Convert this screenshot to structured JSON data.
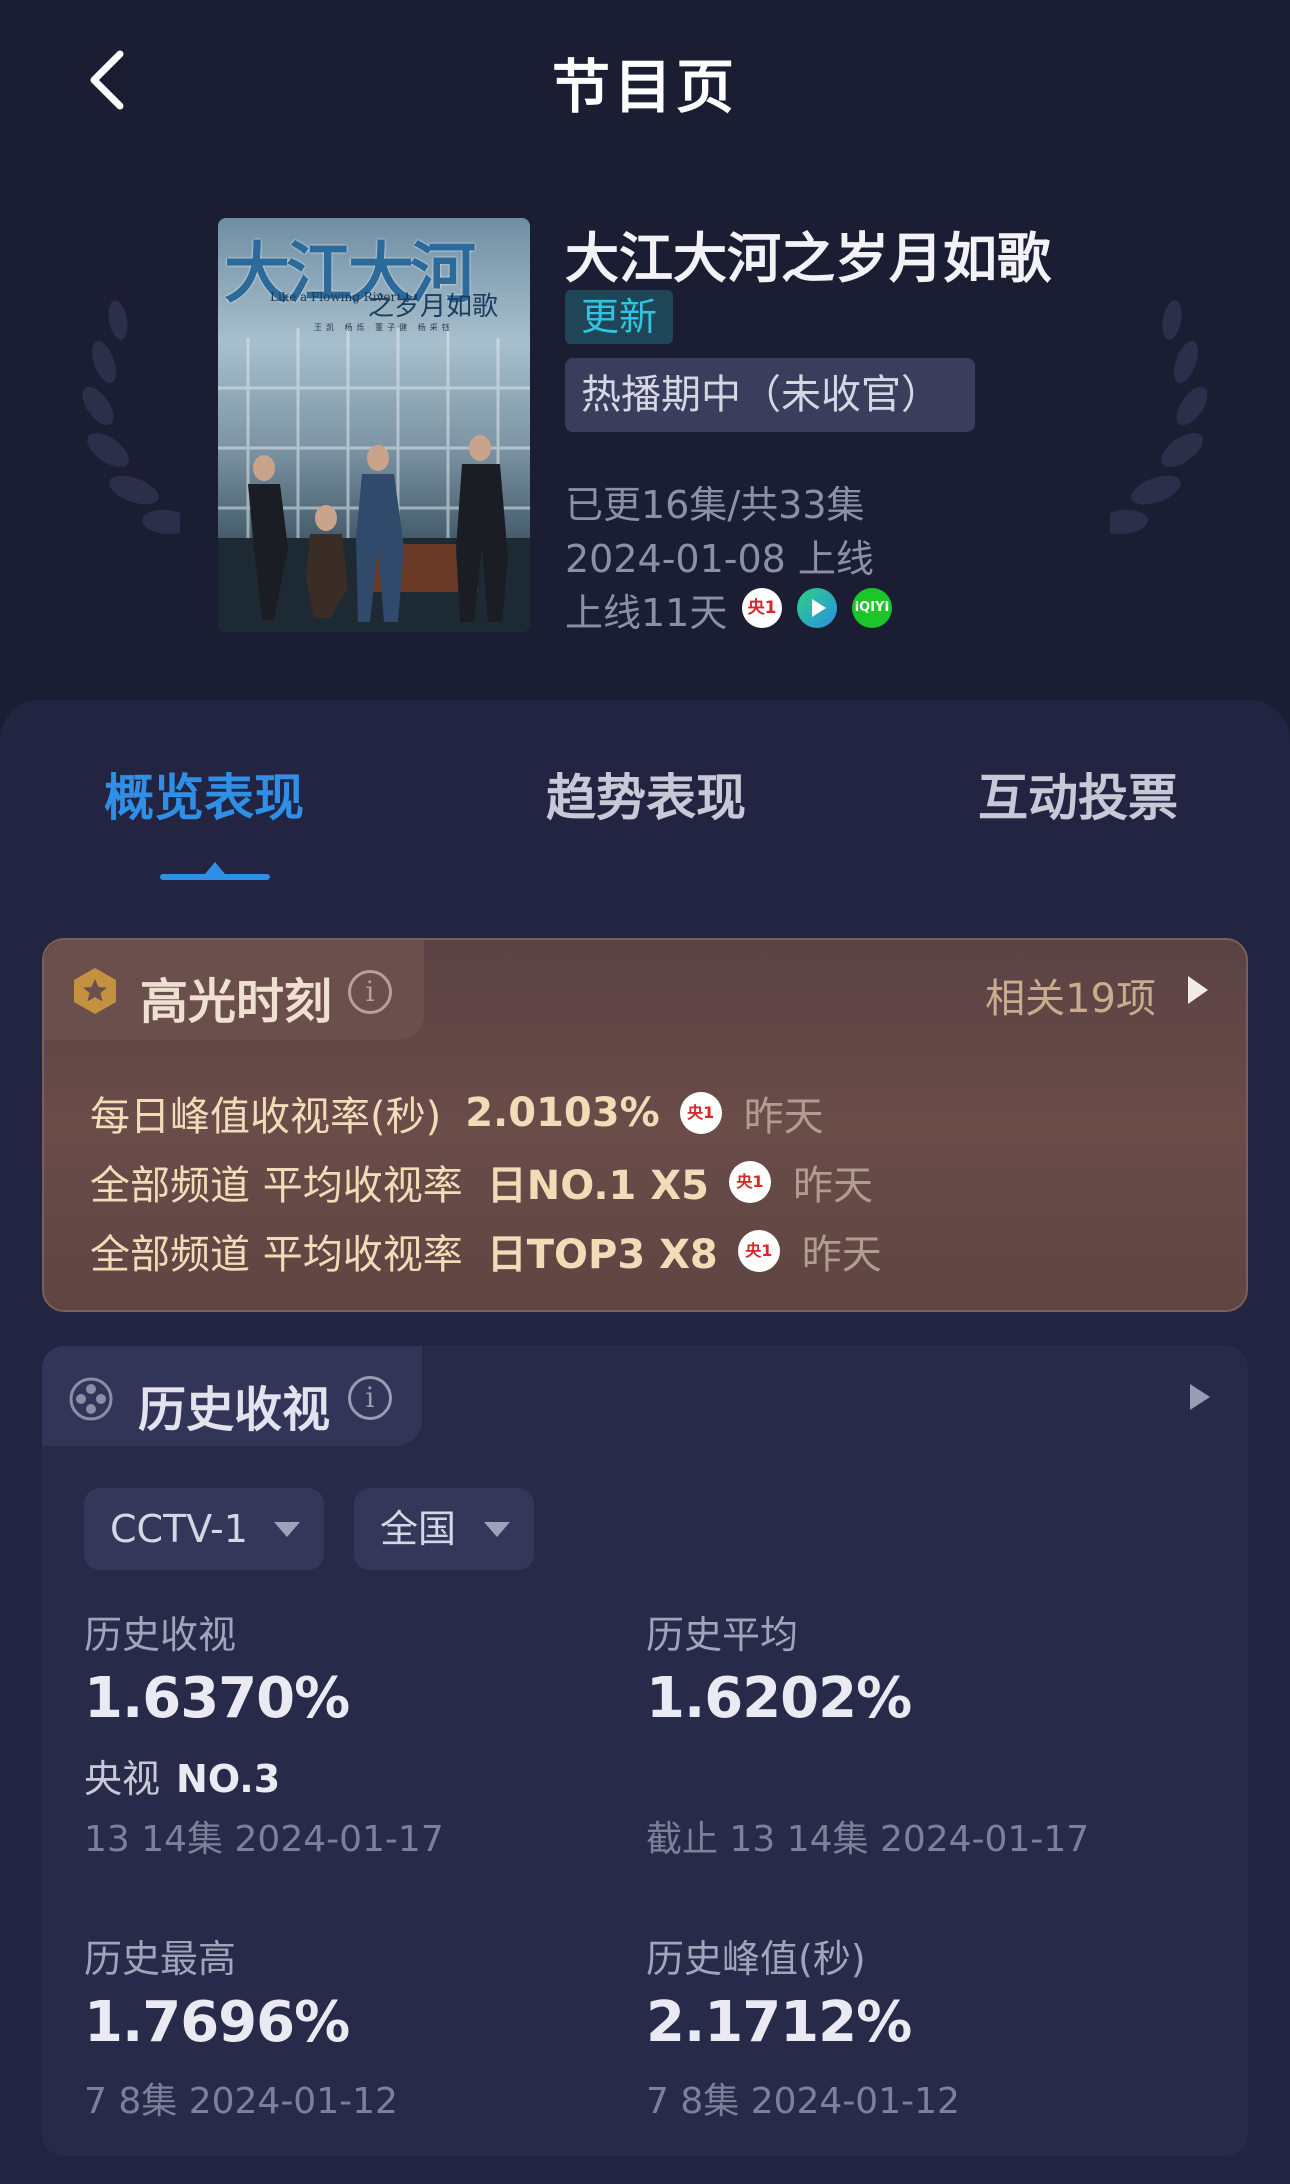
{
  "header": {
    "title": "节目页"
  },
  "show": {
    "poster_title": "大江大河",
    "poster_subtitle": "之岁月如歌",
    "poster_en": "Like a Flowing River",
    "poster_cast": "王凯 杨烁 董子健 杨采钰",
    "name": "大江大河之岁月如歌",
    "badge_update": "更新",
    "status": "热播期中（未收官）",
    "episodes": "已更16集/共33集",
    "release": "2024-01-08 上线",
    "days_online": "上线11天",
    "platform_icons": [
      "cctv1-icon",
      "video-play-icon",
      "iqiyi-icon"
    ],
    "icon_labels": {
      "cctv1": "央1",
      "iqiyi": "iQIYI"
    }
  },
  "tabs": [
    {
      "label": "概览表现",
      "active": true
    },
    {
      "label": "趋势表现",
      "active": false
    },
    {
      "label": "互动投票",
      "active": false
    }
  ],
  "highlights": {
    "title": "高光时刻",
    "more": "相关19项",
    "rows": [
      {
        "label": "每日峰值收视率(秒)",
        "value": "2.0103%",
        "channel": "央1",
        "when": "昨天"
      },
      {
        "label": "全部频道 平均收视率",
        "value": "日NO.1 X5",
        "channel": "央1",
        "when": "昨天"
      },
      {
        "label": "全部频道 平均收视率",
        "value": "日TOP3 X8",
        "channel": "央1",
        "when": "昨天"
      }
    ]
  },
  "history": {
    "title": "历史收视",
    "channel_select": "CCTV-1",
    "region_select": "全国",
    "stats": {
      "hist_rating": {
        "label": "历史收视",
        "value": "1.6370%",
        "rank_label": "央视",
        "rank": "NO.3",
        "meta": "13 14集  2024-01-17"
      },
      "hist_avg": {
        "label": "历史平均",
        "value": "1.6202%",
        "meta": "截止 13 14集  2024-01-17"
      },
      "hist_high": {
        "label": "历史最高",
        "value": "1.7696%",
        "meta": "7 8集  2024-01-12"
      },
      "hist_peak": {
        "label": "历史峰值(秒)",
        "value": "2.1712%",
        "meta": "7 8集  2024-01-12"
      }
    }
  },
  "colors": {
    "background": "#1b1d33",
    "accent": "#2f8fe6",
    "update_badge": "#2fc4e0",
    "highlight_text": "#f2dcb7"
  }
}
